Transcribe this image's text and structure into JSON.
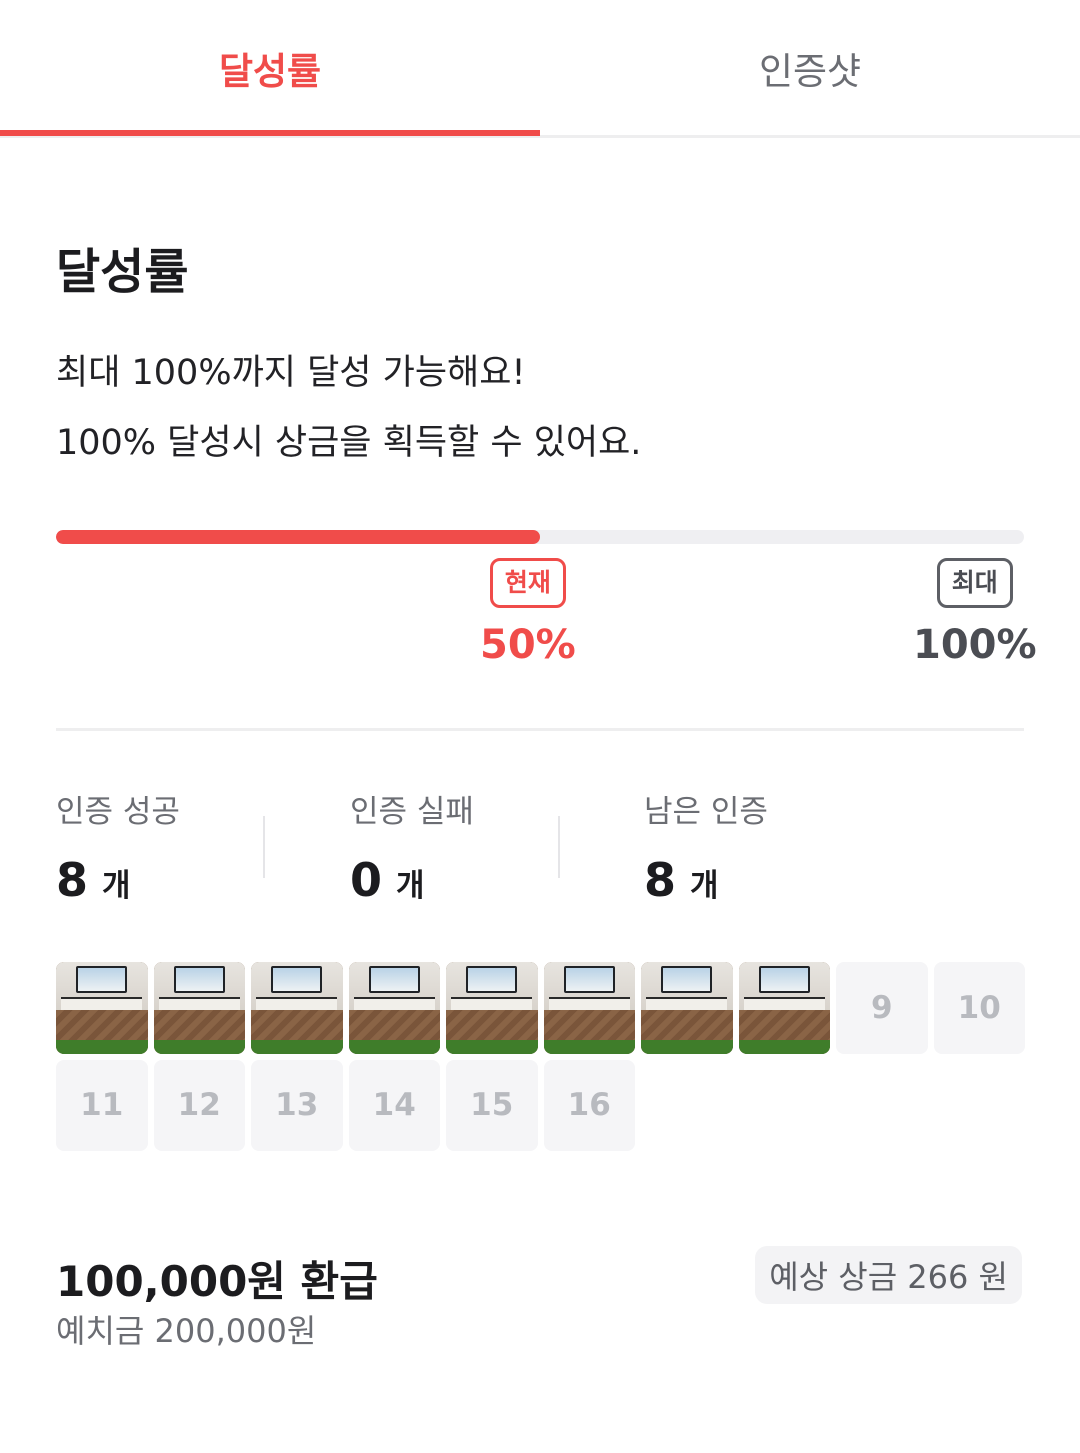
{
  "tabs": [
    {
      "label": "달성률",
      "active": true
    },
    {
      "label": "인증샷",
      "active": false
    }
  ],
  "section": {
    "title": "달성률",
    "desc_line1": "최대 100%까지 달성 가능해요!",
    "desc_line2": "100% 달성시 상금을 획득할 수 있어요."
  },
  "progress": {
    "value": 0.5,
    "current_badge": "현재",
    "current_pct": "50%",
    "max_badge": "최대",
    "max_pct": "100%"
  },
  "stats": [
    {
      "label": "인증 성공",
      "value": "8",
      "unit": "개"
    },
    {
      "label": "인증 실패",
      "value": "0",
      "unit": "개"
    },
    {
      "label": "남은 인증",
      "value": "8",
      "unit": "개"
    }
  ],
  "cells": {
    "photos_count": 8,
    "remaining": [
      "9",
      "10",
      "11",
      "12",
      "13",
      "14",
      "15",
      "16"
    ]
  },
  "summary": {
    "refund": "100,000원 환급",
    "deposit": "예치금 200,000원",
    "expected_prize": "예상 상금 266 원"
  },
  "colors": {
    "accent": "#f04c4a",
    "muted": "#6b6d73",
    "track": "#efeff2"
  }
}
